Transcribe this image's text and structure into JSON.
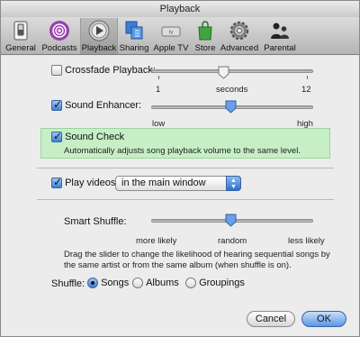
{
  "window": {
    "title": "Playback"
  },
  "toolbar": {
    "items": [
      {
        "label": "General",
        "icon": "general-switch-icon"
      },
      {
        "label": "Podcasts",
        "icon": "podcasts-icon"
      },
      {
        "label": "Playback",
        "icon": "play-icon",
        "selected": true
      },
      {
        "label": "Sharing",
        "icon": "sharing-icon"
      },
      {
        "label": "Apple TV",
        "icon": "apple-tv-icon"
      },
      {
        "label": "Store",
        "icon": "store-bag-icon"
      },
      {
        "label": "Advanced",
        "icon": "gear-icon"
      },
      {
        "label": "Parental",
        "icon": "parental-people-icon"
      }
    ]
  },
  "crossfade": {
    "label": "Crossfade Playback:",
    "checked": false,
    "min_label": "1",
    "mid_label": "seconds",
    "max_label": "12",
    "value": 6,
    "min": 1,
    "max": 12
  },
  "sound_enhancer": {
    "label": "Sound Enhancer:",
    "checked": true,
    "min_label": "low",
    "max_label": "high",
    "value_fraction": 0.5
  },
  "sound_check": {
    "label": "Sound Check",
    "checked": true,
    "description": "Automatically adjusts song playback volume to the same level."
  },
  "play_videos": {
    "label": "Play videos:",
    "checked": true,
    "selected": "in the main window"
  },
  "smart_shuffle": {
    "label": "Smart Shuffle:",
    "left_label": "more likely",
    "mid_label": "random",
    "right_label": "less likely",
    "value_fraction": 0.5,
    "help_line1": "Drag the slider to change the likelihood of hearing sequential songs by",
    "help_line2": "the same artist or from the same album (when shuffle is on)."
  },
  "shuffle": {
    "label": "Shuffle:",
    "options": [
      "Songs",
      "Albums",
      "Groupings"
    ],
    "selected": "Songs"
  },
  "buttons": {
    "cancel": "Cancel",
    "ok": "OK"
  },
  "colors": {
    "highlight_green": "#c6efc6",
    "accent_blue": "#3f7fd6"
  }
}
